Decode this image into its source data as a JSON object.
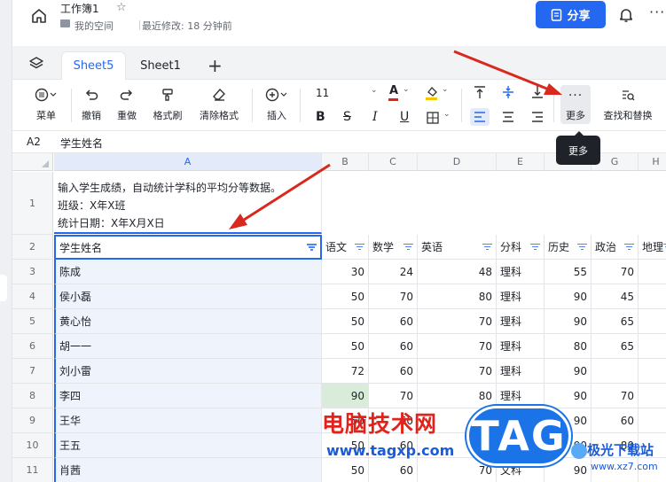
{
  "header": {
    "doc_title": "工作簿1",
    "space_label": "我的空间",
    "modified": "最近修改: 18 分钟前",
    "share_label": "分享"
  },
  "tabs": [
    {
      "label": "Sheet5",
      "active": true
    },
    {
      "label": "Sheet1",
      "active": false
    }
  ],
  "toolbar": {
    "menu": "菜单",
    "undo": "撤销",
    "redo": "重做",
    "format_painter": "格式刷",
    "clear_format": "清除格式",
    "insert": "插入",
    "font_size": "11",
    "more": "更多",
    "find_replace": "查找和替换",
    "tooltip": "更多"
  },
  "formula_bar": {
    "cell_ref": "A2",
    "content": "学生姓名"
  },
  "columns": [
    "A",
    "B",
    "C",
    "D",
    "E",
    "F",
    "G",
    "H"
  ],
  "description": [
    "输入学生成绩，自动统计学科的平均分等数据。",
    "班级：X年X班",
    "统计日期：X年X月X日"
  ],
  "table_headers": [
    "学生姓名",
    "语文",
    "数学",
    "英语",
    "分科",
    "历史",
    "政治",
    "地理"
  ],
  "rows": [
    {
      "num": "3",
      "cells": [
        "陈成",
        "30",
        "24",
        "48",
        "理科",
        "55",
        "70",
        ""
      ]
    },
    {
      "num": "4",
      "cells": [
        "侯小磊",
        "50",
        "70",
        "80",
        "理科",
        "90",
        "45",
        ""
      ]
    },
    {
      "num": "5",
      "cells": [
        "黄心怡",
        "50",
        "60",
        "70",
        "理科",
        "90",
        "65",
        ""
      ]
    },
    {
      "num": "6",
      "cells": [
        "胡一一",
        "50",
        "60",
        "70",
        "理科",
        "80",
        "65",
        ""
      ]
    },
    {
      "num": "7",
      "cells": [
        "刘小雷",
        "72",
        "60",
        "70",
        "理科",
        "90",
        "",
        ""
      ]
    },
    {
      "num": "8",
      "cells": [
        "李四",
        "90",
        "70",
        "80",
        "理科",
        "90",
        "70",
        ""
      ]
    },
    {
      "num": "9",
      "cells": [
        "王华",
        "50",
        "60",
        "70",
        "理科",
        "90",
        "60",
        ""
      ]
    },
    {
      "num": "10",
      "cells": [
        "王五",
        "50",
        "60",
        "80",
        "文科",
        "90",
        "80",
        ""
      ]
    },
    {
      "num": "11",
      "cells": [
        "肖茜",
        "50",
        "60",
        "70",
        "文科",
        "90",
        "",
        ""
      ]
    }
  ],
  "row_numbers": {
    "desc": "1",
    "header": "2"
  },
  "watermark": {
    "site_cn": "电脑技术网",
    "site_url": "www.tagxp.com",
    "logo": "TAG",
    "site2_cn": "极光下载站",
    "site2_url": "www.xz7.com"
  },
  "colors": {
    "accent": "#2468f2",
    "arrow": "#d9281e"
  }
}
